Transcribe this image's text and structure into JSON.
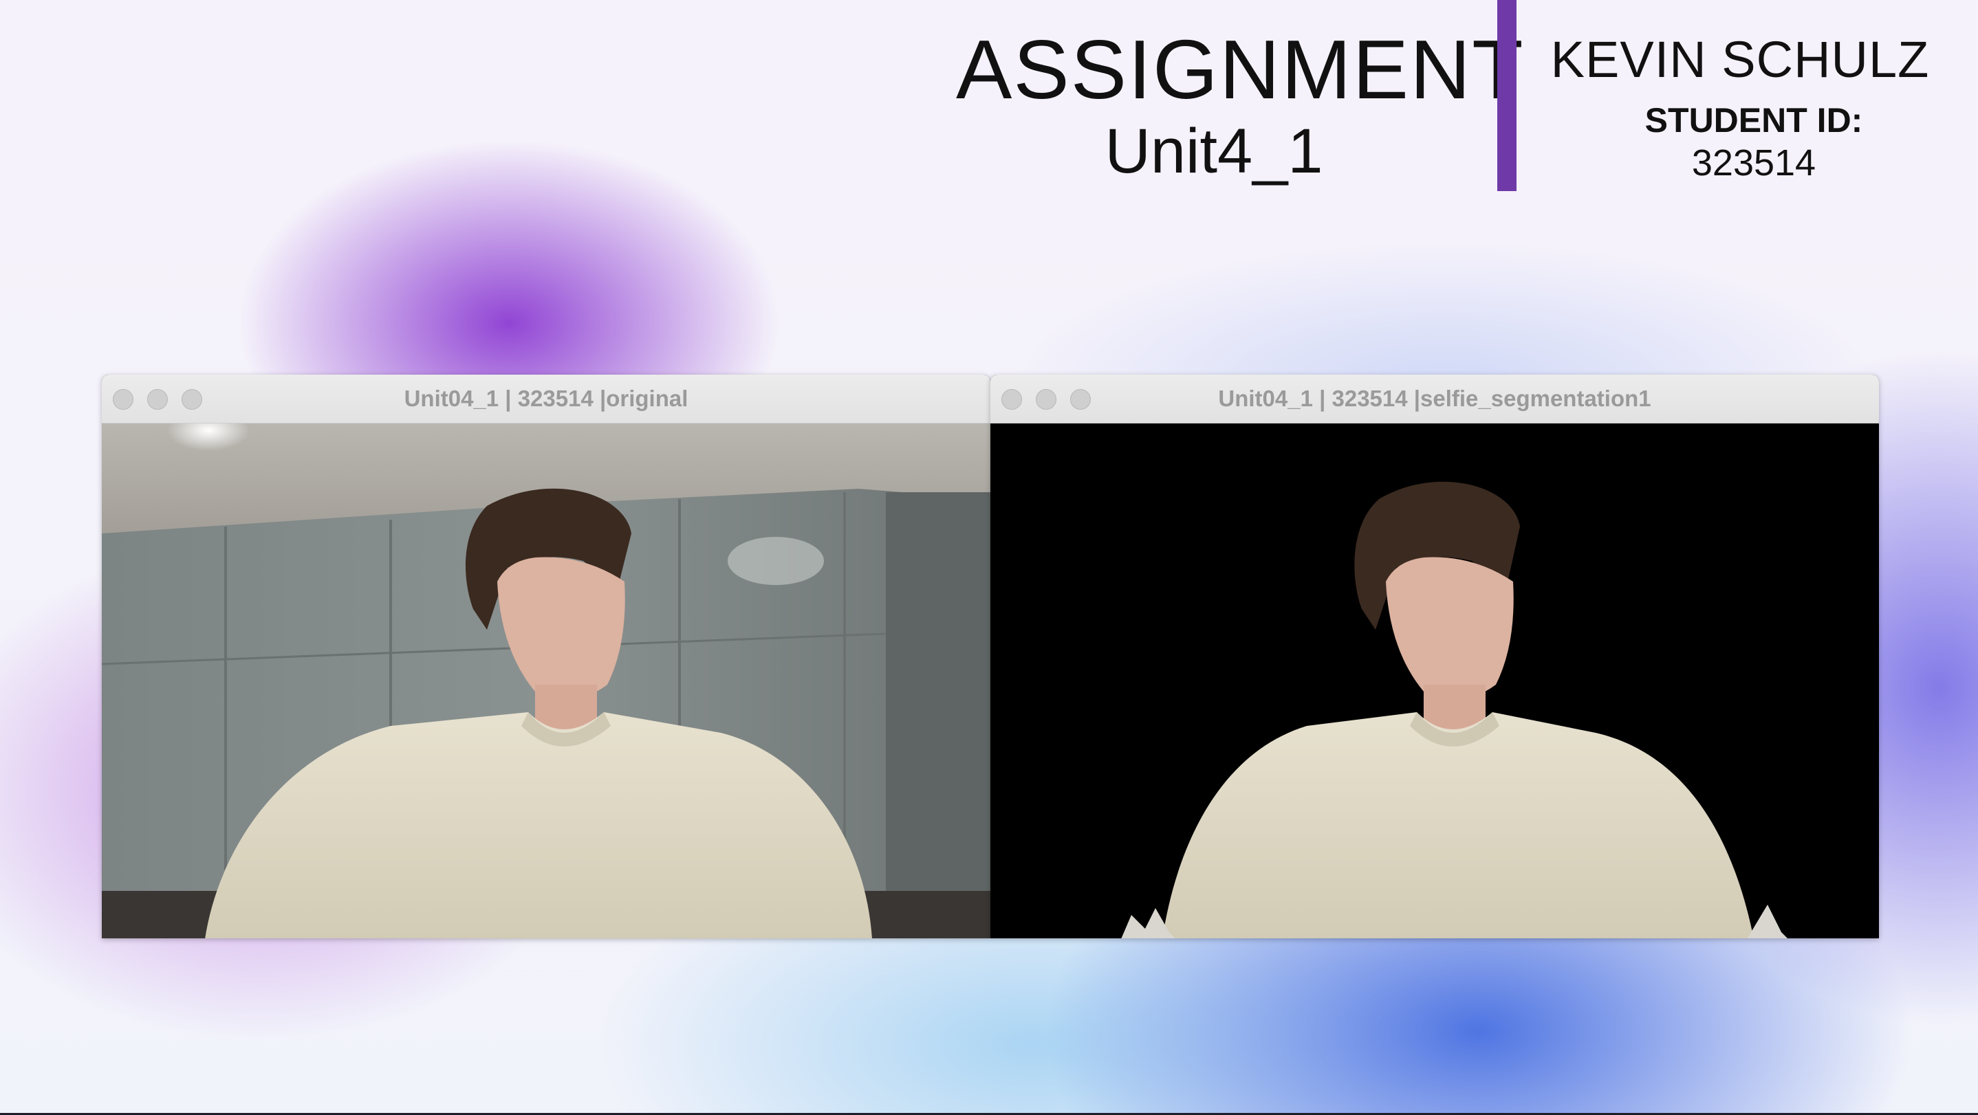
{
  "header": {
    "title": "ASSIGNMENT",
    "subtitle": "Unit4_1",
    "student_name": "KEVIN SCHULZ",
    "student_id_label": "STUDENT ID:",
    "student_id": "323514",
    "accent_color": "#6f3aa8"
  },
  "windows": [
    {
      "title": "Unit04_1 | 323514 |original",
      "content": "webcam-frame-original"
    },
    {
      "title": "Unit04_1 | 323514 |selfie_segmentation1",
      "content": "webcam-frame-segmented"
    }
  ]
}
